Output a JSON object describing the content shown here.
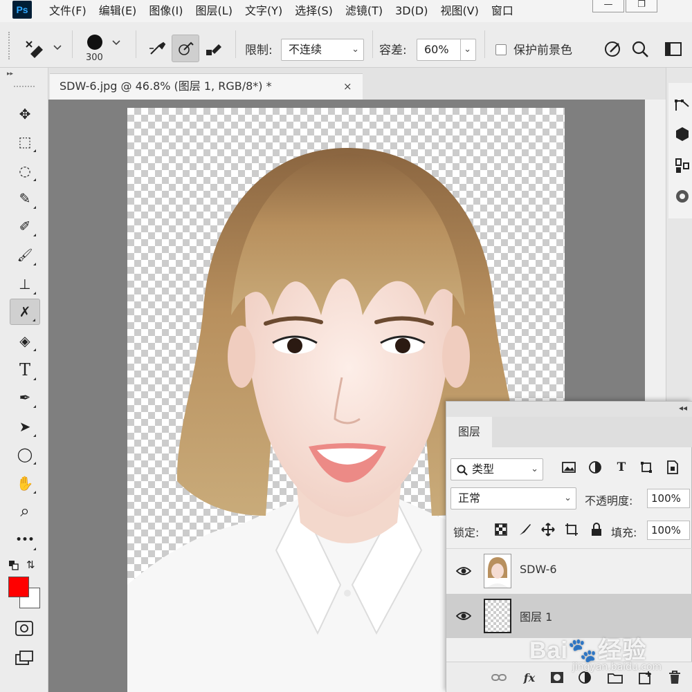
{
  "app": {
    "logo": "Ps"
  },
  "menu": [
    "文件(F)",
    "编辑(E)",
    "图像(I)",
    "图层(L)",
    "文字(Y)",
    "选择(S)",
    "滤镜(T)",
    "3D(D)",
    "视图(V)",
    "窗口"
  ],
  "window_controls": {
    "minimize": "—",
    "restore": "❐"
  },
  "options": {
    "brush_size": "300",
    "limit_label": "限制:",
    "limit_value": "不连续",
    "tolerance_label": "容差:",
    "tolerance_value": "60%",
    "protect_fg_label": "保护前景色",
    "protect_fg_checked": false
  },
  "document": {
    "tab_title": "SDW-6.jpg @ 46.8% (图层 1, RGB/8*) *",
    "close_glyph": "×"
  },
  "colors": {
    "foreground": "#ff0000",
    "background": "#ffffff",
    "canvas_bg": "#7f7f7f"
  },
  "tools": [
    {
      "name": "move-tool-icon",
      "glyph": "✥"
    },
    {
      "name": "marquee-tool-icon",
      "glyph": "⬚"
    },
    {
      "name": "lasso-tool-icon",
      "glyph": "◌"
    },
    {
      "name": "quick-select-tool-icon",
      "glyph": "✎"
    },
    {
      "name": "eyedropper-tool-icon",
      "glyph": "✐"
    },
    {
      "name": "brush-tool-icon",
      "glyph": "🖌"
    },
    {
      "name": "stamp-tool-icon",
      "glyph": "⊥"
    },
    {
      "name": "background-eraser-tool-icon",
      "glyph": "✗",
      "active": true
    },
    {
      "name": "paint-bucket-tool-icon",
      "glyph": "◈"
    },
    {
      "name": "type-tool-icon",
      "glyph": "T"
    },
    {
      "name": "pen-tool-icon",
      "glyph": "✒"
    },
    {
      "name": "path-select-tool-icon",
      "glyph": "➤"
    },
    {
      "name": "ellipse-tool-icon",
      "glyph": "◯"
    },
    {
      "name": "hand-tool-icon",
      "glyph": "✋"
    },
    {
      "name": "zoom-tool-icon",
      "glyph": "⌕"
    },
    {
      "name": "more-tools-icon",
      "glyph": "•••"
    }
  ],
  "layers_panel": {
    "tab_label": "图层",
    "filter_value": "类型",
    "blend_mode": "正常",
    "opacity_label": "不透明度:",
    "opacity_value": "100%",
    "lock_label": "锁定:",
    "fill_label": "填充:",
    "fill_value": "100%",
    "layers": [
      {
        "name": "SDW-6",
        "visible": true,
        "selected": false
      },
      {
        "name": "图层 1",
        "visible": true,
        "selected": true
      }
    ],
    "footer_fx": "fx"
  },
  "watermark": {
    "text": "Bai🐾经验",
    "url": "jingyan.baidu.com"
  }
}
